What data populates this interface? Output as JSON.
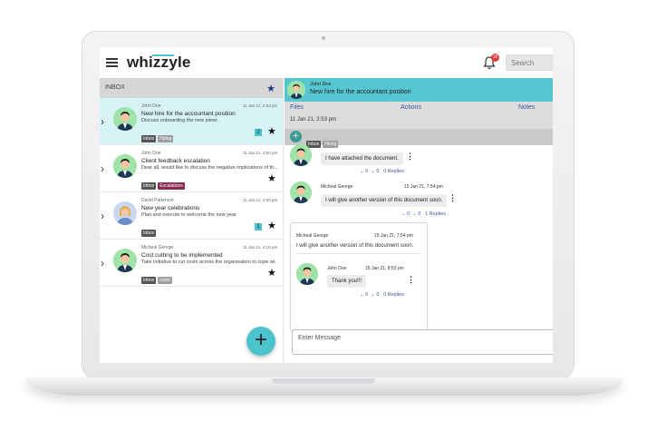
{
  "app": {
    "logo": "whizzyle",
    "notification_count": "10",
    "search_placeholder": "Search"
  },
  "inbox": {
    "title": "INBOX",
    "mails": [
      {
        "sender": "John Doe",
        "date": "11 Jan 21, 2:53 pm",
        "subject": "New hire for the accountant position",
        "preview": "Discuss onboarding the new joiner.",
        "tags": [
          "Inbox",
          "Hiring"
        ],
        "count": "2",
        "selected": true
      },
      {
        "sender": "John Doe",
        "date": "11 Jan 21, 4:50 pm",
        "subject": "Client feedback escalation",
        "preview": "Dear all, would like to discuss the negative implications of th...",
        "tags": [
          "Inbox",
          "Escalations"
        ],
        "count": "",
        "selected": false
      },
      {
        "sender": "David Patterson",
        "date": "11 Jan 21, 4:50 pm",
        "subject": "New year celebrations",
        "preview": "Plan and execute to welcome the new year",
        "tags": [
          "Inbox"
        ],
        "count": "1",
        "selected": false
      },
      {
        "sender": "Micheal George",
        "date": "11 Jan 21, 4:16 pm",
        "subject": "Cost cutting to be implemented",
        "preview": "Take initiative to cut costs across the organisation to cope wi...",
        "tags": [
          "Inbox",
          "crisis"
        ],
        "count": "",
        "selected": false
      }
    ]
  },
  "thread": {
    "sender": "John Doe",
    "subject": "New hire for the accountant position",
    "tabs": [
      "Files",
      "Actions",
      "Notes"
    ],
    "date": "11 Jan 21, 2:53 pm",
    "tags": [
      "Inbox",
      "Hiring"
    ],
    "messages": [
      {
        "text": "I have attached the document.",
        "up": "0",
        "down": "0",
        "replies": "0 Replies"
      },
      {
        "sender": "Micheal George",
        "date": "15 Jan 21, 7:54 pm",
        "text": "I will give another version of this document soon.",
        "up": "0",
        "down": "0",
        "replies": "1 Replies"
      }
    ],
    "reply_card": {
      "sender": "Micheal George",
      "date": "15 Jan 21, 7:54 pm",
      "text": "I will give another version of this document soon.",
      "reply": {
        "sender": "John Doe",
        "date": "15 Jan 21, 8:53 pm",
        "text": "Thank you!!!",
        "up": "0",
        "down": "0",
        "replies": "0 Replies"
      }
    },
    "composer_placeholder": "Enter Message"
  }
}
